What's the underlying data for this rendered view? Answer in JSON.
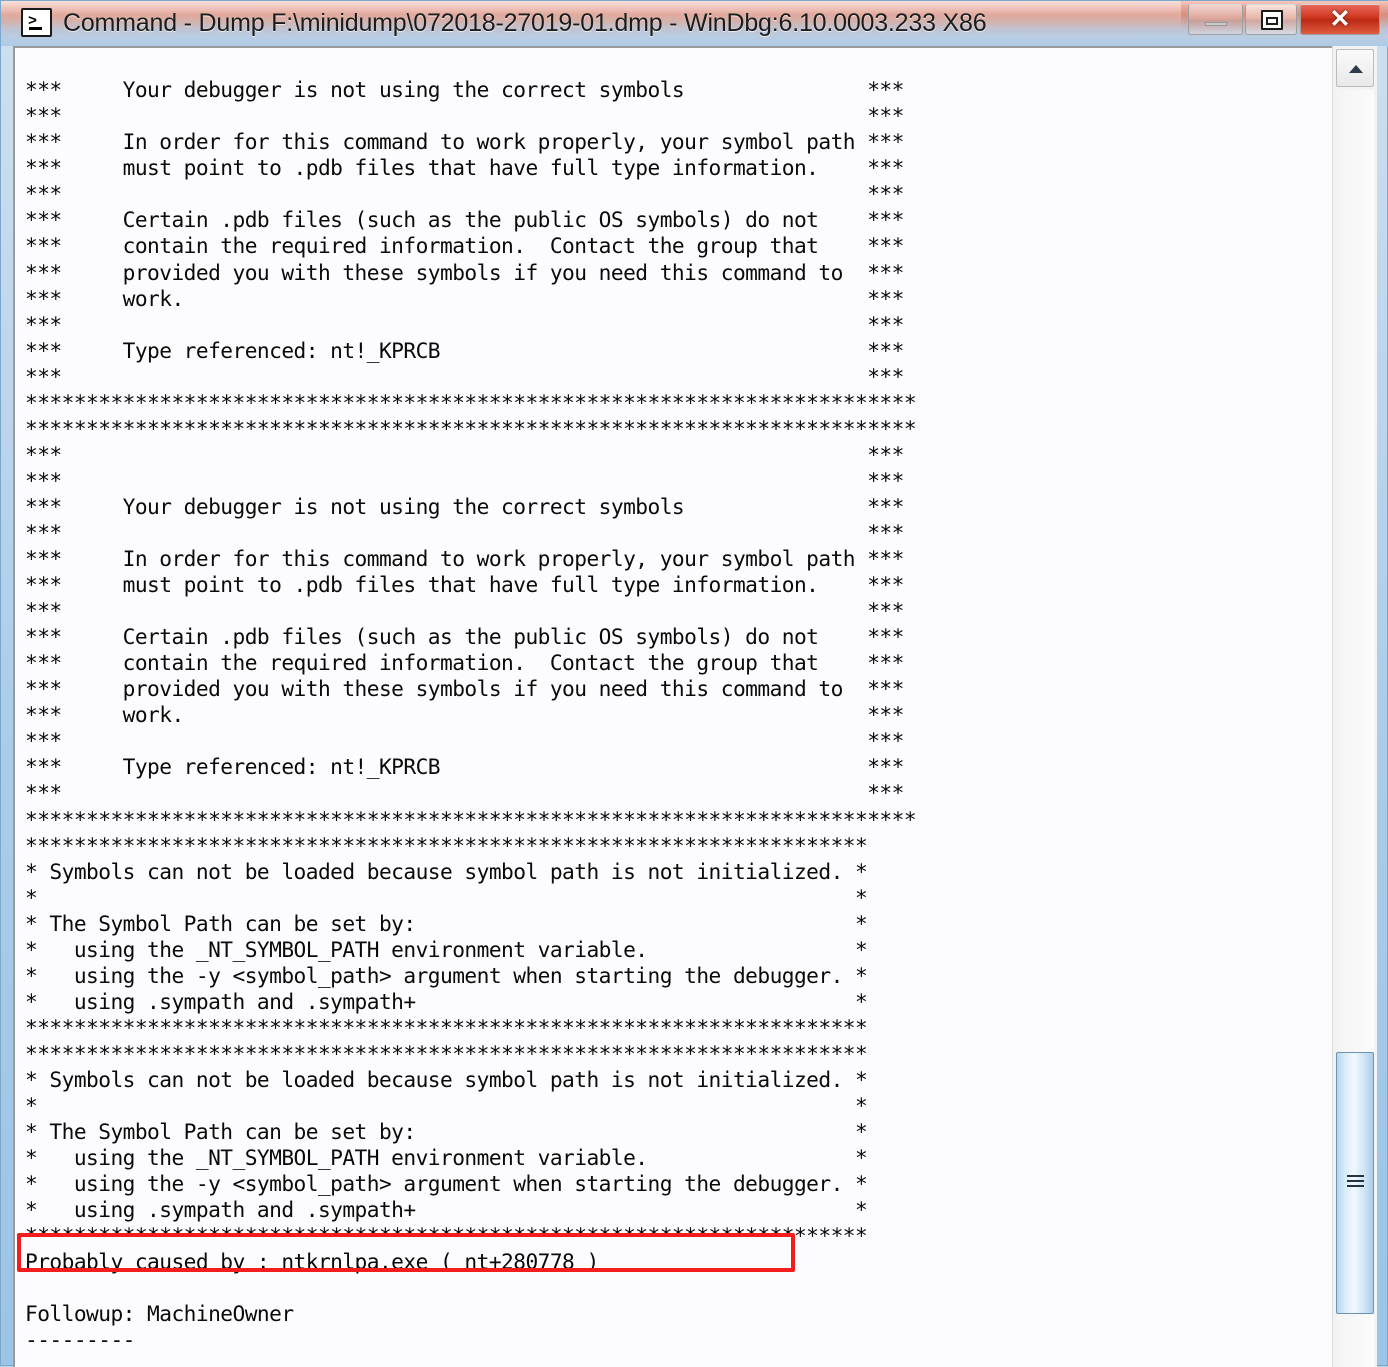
{
  "window": {
    "title": "Command - Dump F:\\minidump\\072018-27019-01.dmp - WinDbg:6.10.0003.233 X86",
    "icon": "console-icon",
    "controls": {
      "minimize": "—",
      "maximize": "□",
      "close": "✕"
    }
  },
  "colors": {
    "highlight_border": "#f41d1d",
    "close_button": "#d23a23",
    "text": "#0a0a0a",
    "background": "#fcfcfe",
    "scrollbar_thumb": "#b7d6ef"
  },
  "scrollbar": {
    "up_arrow": "chevron-up-icon",
    "thumb_position": "near-bottom"
  },
  "highlight": {
    "label": "Probably caused by : ntkrnlpa.exe ( nt+280778 )"
  },
  "console": {
    "text": "***     Your debugger is not using the correct symbols               ***\n***                                                                  ***\n***     In order for this command to work properly, your symbol path ***\n***     must point to .pdb files that have full type information.    ***\n***                                                                  ***\n***     Certain .pdb files (such as the public OS symbols) do not    ***\n***     contain the required information.  Contact the group that    ***\n***     provided you with these symbols if you need this command to  ***\n***     work.                                                        ***\n***                                                                  ***\n***     Type referenced: nt!_KPRCB                                   ***\n***                                                                  ***\n*************************************************************************\n*************************************************************************\n***                                                                  ***\n***                                                                  ***\n***     Your debugger is not using the correct symbols               ***\n***                                                                  ***\n***     In order for this command to work properly, your symbol path ***\n***     must point to .pdb files that have full type information.    ***\n***                                                                  ***\n***     Certain .pdb files (such as the public OS symbols) do not    ***\n***     contain the required information.  Contact the group that    ***\n***     provided you with these symbols if you need this command to  ***\n***     work.                                                        ***\n***                                                                  ***\n***     Type referenced: nt!_KPRCB                                   ***\n***                                                                  ***\n*************************************************************************\n*********************************************************************\n* Symbols can not be loaded because symbol path is not initialized. *\n*                                                                   *\n* The Symbol Path can be set by:                                    *\n*   using the _NT_SYMBOL_PATH environment variable.                 *\n*   using the -y <symbol_path> argument when starting the debugger. *\n*   using .sympath and .sympath+                                    *\n*********************************************************************\n*********************************************************************\n* Symbols can not be loaded because symbol path is not initialized. *\n*                                                                   *\n* The Symbol Path can be set by:                                    *\n*   using the _NT_SYMBOL_PATH environment variable.                 *\n*   using the -y <symbol_path> argument when starting the debugger. *\n*   using .sympath and .sympath+                                    *\n*********************************************************************\nProbably caused by : ntkrnlpa.exe ( nt+280778 )\n\nFollowup: MachineOwner\n---------\n"
  }
}
